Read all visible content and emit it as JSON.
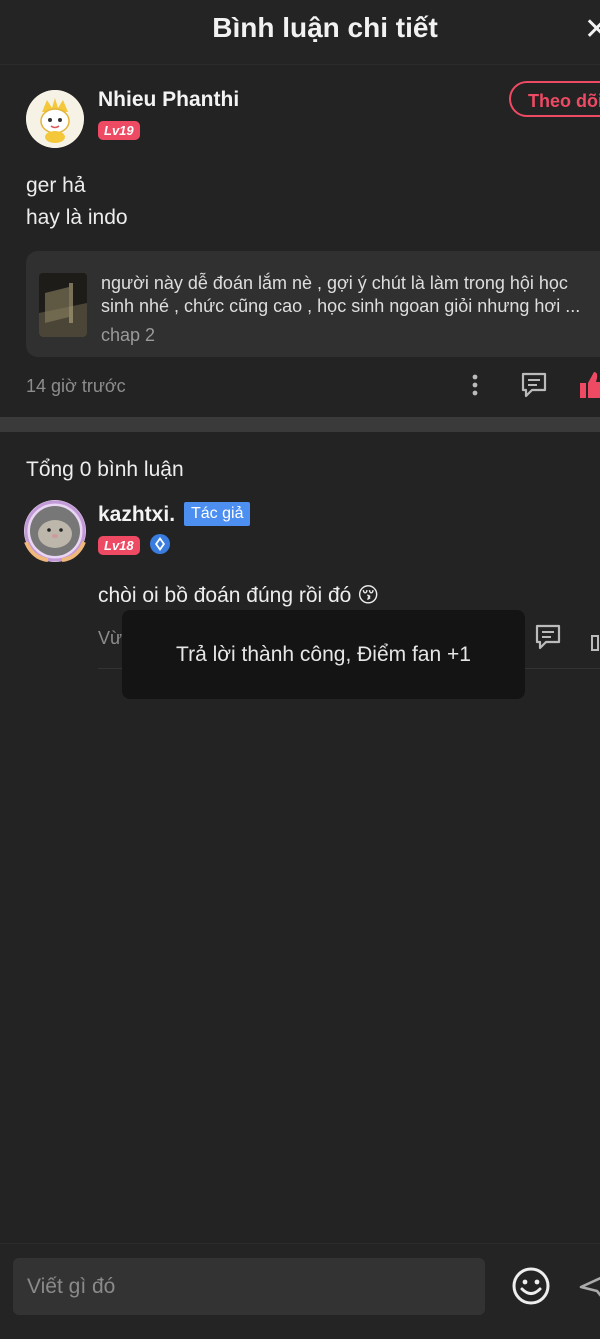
{
  "header": {
    "title": "Bình luận chi tiết",
    "close_glyph": "✕"
  },
  "main_comment": {
    "user": {
      "name": "Nhieu Phanthi",
      "level": "Lv19"
    },
    "follow_label": "Theo dõi",
    "lines": [
      "ger hả",
      "hay là indo"
    ],
    "reference": {
      "text": "người này dễ đoán lắm nè , gợi ý chút là làm trong hội học sinh nhé , chức cũng cao , học sinh ngoan giỏi nhưng hơi ...",
      "chapter": "chap 2"
    },
    "time": "14 giờ trước"
  },
  "replies": {
    "total_label": "Tổng 0 bình luận",
    "items": [
      {
        "name": "kazhtxi.",
        "badge": "Tác giả",
        "level": "Lv18",
        "text": "chòi oi bồ đoán đúng rồi đó 😚",
        "time": "Vừa mới"
      }
    ]
  },
  "toast": {
    "message": "Trả lời thành công, Điểm fan +1"
  },
  "composer": {
    "placeholder": "Viết gì đó"
  },
  "colors": {
    "accent": "#ef4a63",
    "author_badge": "#4d8ff0",
    "background": "#232323"
  }
}
